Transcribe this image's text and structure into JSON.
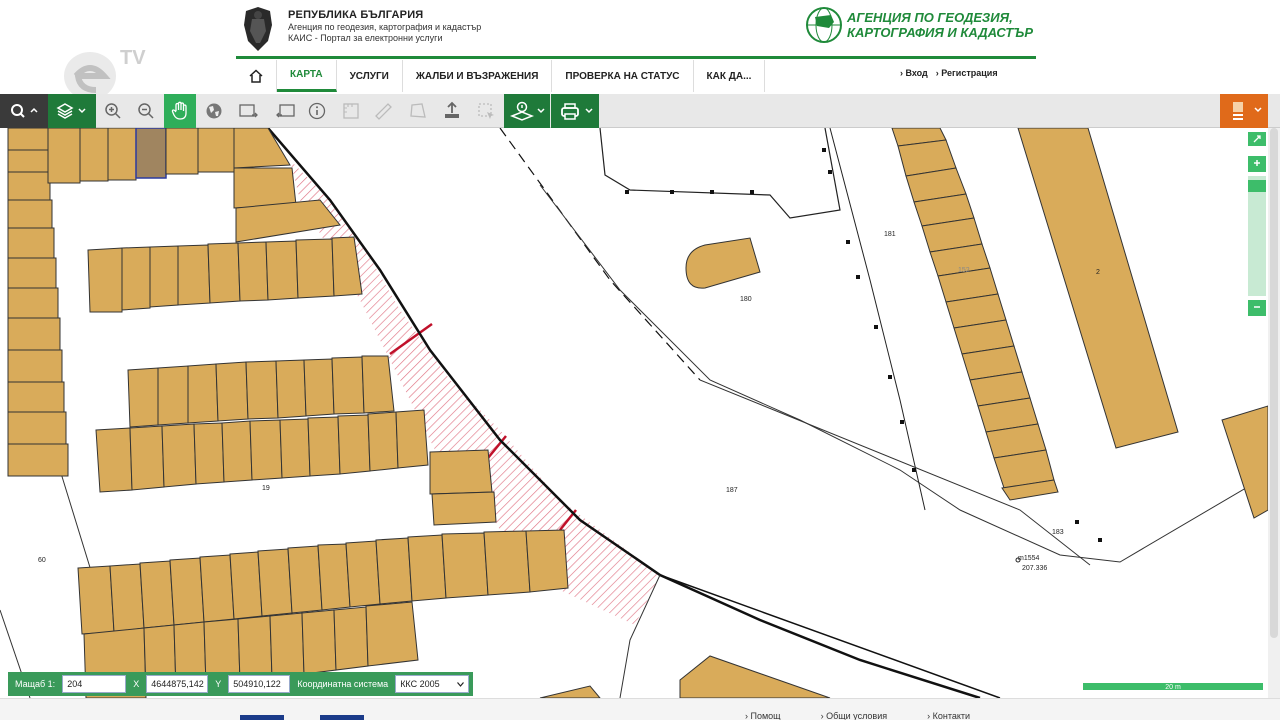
{
  "header": {
    "republic_title": "РЕПУБЛИКА БЪЛГАРИЯ",
    "agency_line": "Агенция по геодезия, картография и кадастър",
    "portal_line": "КАИС - Портал за електронни услуги",
    "agency_logo_line1": "АГЕНЦИЯ ПО ГЕОДЕЗИЯ,",
    "agency_logo_line2": "КАРТОГРАФИЯ И КАДАСТЪР"
  },
  "nav": {
    "items": [
      {
        "label": "КАРТА"
      },
      {
        "label": "УСЛУГИ"
      },
      {
        "label": "ЖАЛБИ И ВЪЗРАЖЕНИЯ"
      },
      {
        "label": "ПРОВЕРКА НА СТАТУС"
      },
      {
        "label": "КАК ДА..."
      }
    ],
    "login": "Вход",
    "register": "Регистрация"
  },
  "watermark": "TV",
  "coords": {
    "scale_label": "Мащаб 1:",
    "scale_value": "204",
    "x_label": "X",
    "x_value": "4644875,142",
    "y_label": "Y",
    "y_value": "504910,122",
    "system_label": "Координатна система",
    "system_value": "ККС 2005"
  },
  "scale_bar": "20 m",
  "map_labels": {
    "l181": "181",
    "l180": "180",
    "l187": "187",
    "l183": "183",
    "l19": "19",
    "l60": "60",
    "l152": "152",
    "l2": "2",
    "point": "m1554",
    "point_val": "207.336"
  },
  "footer": {
    "help": "Помощ",
    "terms": "Общи условия",
    "contacts": "Контакти"
  },
  "colors": {
    "brand_green": "#1f8a3a",
    "parcel_fill": "#d9ab5a",
    "hatch": "#e07585",
    "toolbar_orange": "#e06a1a"
  }
}
